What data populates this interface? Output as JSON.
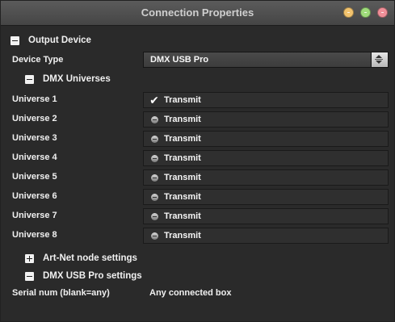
{
  "window": {
    "title": "Connection Properties"
  },
  "colors": {
    "minimize": "#ff9aa8",
    "zoom": "#a8ff90",
    "close": "#ff7070"
  },
  "output_device": {
    "header": "Output Device",
    "device_type_label": "Device Type",
    "device_type_value": "DMX USB Pro"
  },
  "dmx_universes": {
    "header": "DMX Universes",
    "items": [
      {
        "label": "Universe 1",
        "option": "Transmit",
        "checked": true
      },
      {
        "label": "Universe 2",
        "option": "Transmit",
        "checked": false
      },
      {
        "label": "Universe 3",
        "option": "Transmit",
        "checked": false
      },
      {
        "label": "Universe 4",
        "option": "Transmit",
        "checked": false
      },
      {
        "label": "Universe 5",
        "option": "Transmit",
        "checked": false
      },
      {
        "label": "Universe 6",
        "option": "Transmit",
        "checked": false
      },
      {
        "label": "Universe 7",
        "option": "Transmit",
        "checked": false
      },
      {
        "label": "Universe 8",
        "option": "Transmit",
        "checked": false
      }
    ]
  },
  "artnet": {
    "header": "Art-Net node settings"
  },
  "dmx_usb_pro": {
    "header": "DMX USB Pro settings",
    "serial_label": "Serial num (blank=any)",
    "serial_value": "Any connected box"
  },
  "icons": {
    "collapse": "minus-square-icon",
    "expand": "plus-square-icon",
    "checked": "checkmark-icon",
    "unchecked": "round-checkbox-icon"
  }
}
